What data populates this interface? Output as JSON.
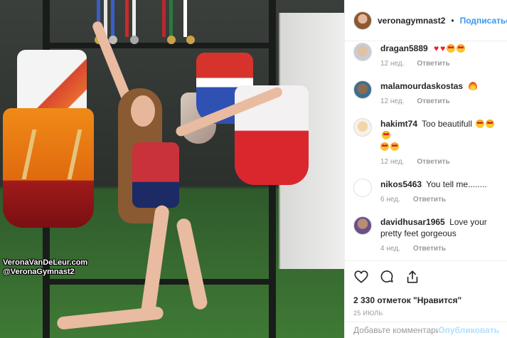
{
  "photo": {
    "watermark_line1": "VeronaVanDeLeur.com",
    "watermark_line2": "@VeronaGymnast2"
  },
  "header": {
    "username": "veronagymnast2",
    "separator": "•",
    "follow_label": "Подписаться"
  },
  "comments": [
    {
      "username": "dragan5889",
      "text": "",
      "emojis": [
        "heart",
        "heart",
        "eyes",
        "eyes"
      ],
      "time": "12 нед.",
      "reply": "Ответить"
    },
    {
      "username": "malamourdaskostas",
      "text": "",
      "emojis": [
        "fire"
      ],
      "time": "12 нед.",
      "reply": "Ответить"
    },
    {
      "username": "hakimt74",
      "text": "Too beautifull",
      "emojis": [
        "eyes",
        "eyes",
        "eyes",
        "eyes",
        "eyes"
      ],
      "time": "12 нед.",
      "reply": "Ответить"
    },
    {
      "username": "nikos5463",
      "text": "You tell me........",
      "emojis": [],
      "time": "6 нед.",
      "reply": "Ответить"
    },
    {
      "username": "davidhusar1965",
      "text": "Love your pretty feet gorgeous",
      "emojis": [],
      "time": "4 нед.",
      "reply": "Ответить"
    }
  ],
  "icons": [
    "heart-icon",
    "comment-icon",
    "share-icon"
  ],
  "likes": "2 330 отметок \"Нравится\"",
  "date": "25 ИЮЛЬ",
  "add_comment": {
    "placeholder": "Добавьте комментарий...",
    "publish_label": "Опубликовать"
  },
  "colors": {
    "accent": "#3897f0",
    "publish_disabled": "#b2dffc",
    "meta": "#999999"
  }
}
